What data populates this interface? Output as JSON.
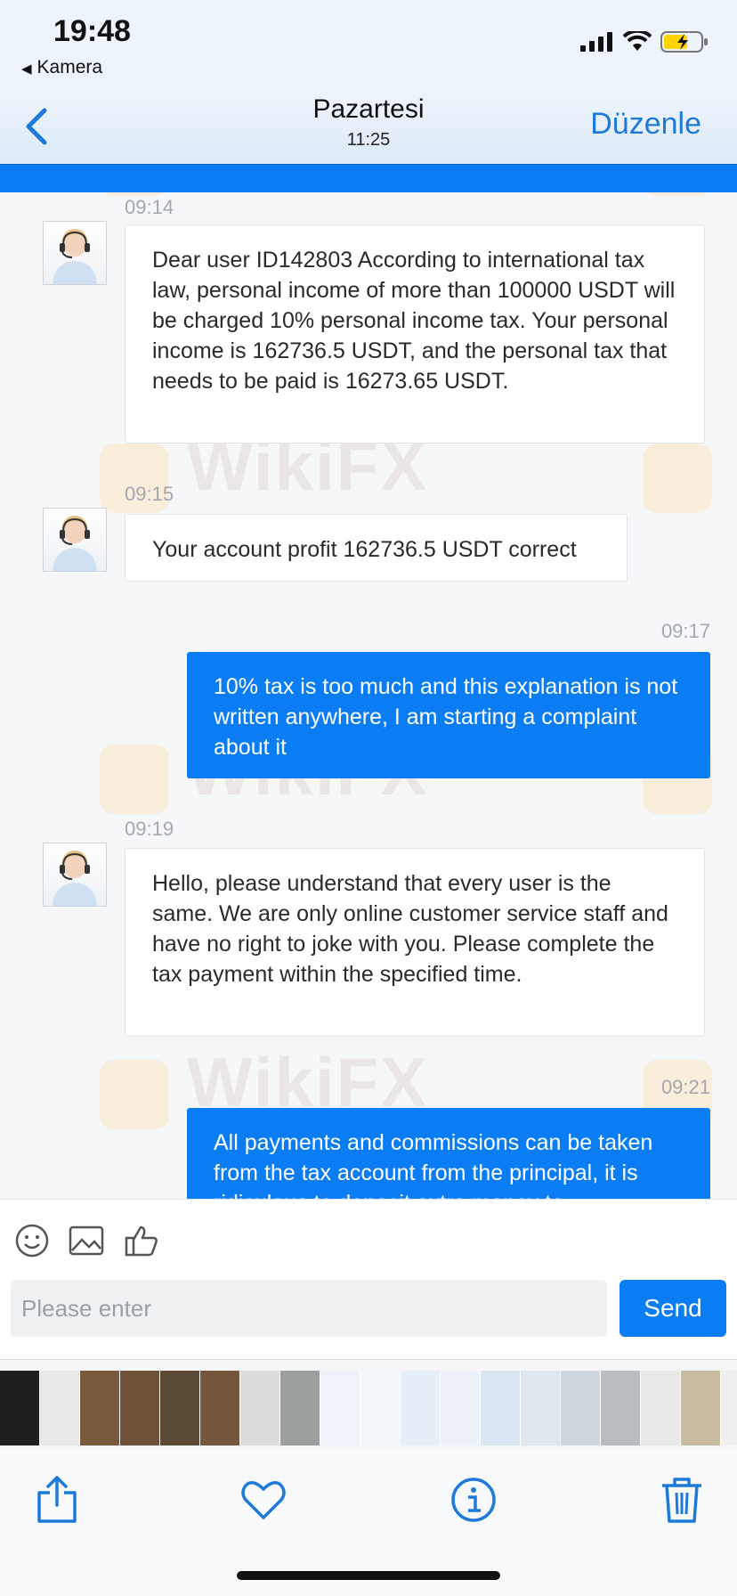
{
  "status_bar": {
    "time": "19:48",
    "back_app": "Kamera"
  },
  "nav": {
    "title": "Pazartesi",
    "subtitle": "11:25",
    "edit": "Düzenle"
  },
  "messages": [
    {
      "direction": "in",
      "time": "09:14",
      "text": "Dear user ID142803 According to international tax law, personal income of more than 100000 USDT will be charged 10% personal income tax. Your personal income is 162736.5 USDT, and the personal tax that needs to be paid is 16273.65 USDT."
    },
    {
      "direction": "in",
      "time": "09:15",
      "text": "Your account profit 162736.5 USDT correct"
    },
    {
      "direction": "out",
      "time": "09:17",
      "text": "10% tax is too much and this explanation is not written anywhere, I am starting a complaint about it"
    },
    {
      "direction": "in",
      "time": "09:19",
      "text": "Hello, please understand that every user is the same. We are only online customer service staff and have no right to joke with you. Please complete the tax payment within the specified time."
    },
    {
      "direction": "out",
      "time": "09:21",
      "text": "All payments and commissions can be taken from the tax account from the principal, it is ridiculous to deposit extra money to"
    }
  ],
  "watermark": "WikiFX",
  "composer": {
    "placeholder": "Please enter",
    "send": "Send"
  },
  "icons": {
    "composer": [
      "emoji-icon",
      "image-icon",
      "thumbs-up-icon"
    ],
    "toolbar": [
      "share-icon",
      "heart-icon",
      "info-icon",
      "trash-icon"
    ]
  },
  "colors": {
    "accent": "#0a7df5",
    "link": "#1e7ad9",
    "outgoing_bubble": "#0a7df5",
    "incoming_bubble": "#ffffff"
  }
}
